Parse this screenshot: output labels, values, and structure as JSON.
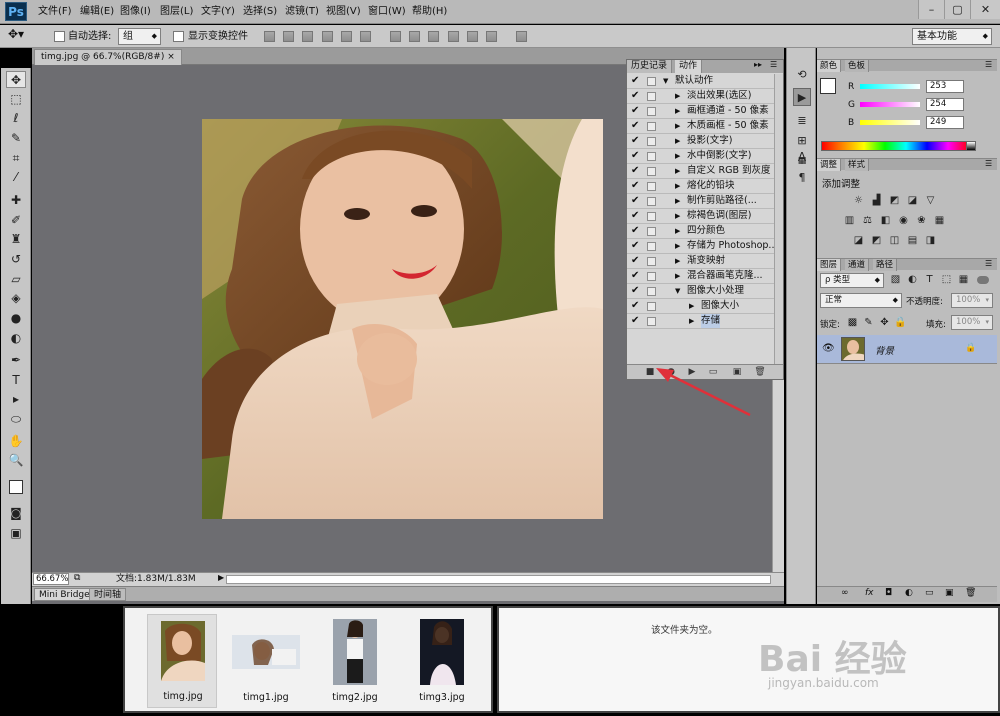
{
  "app": {
    "logo": "Ps",
    "menus": [
      "文件(F)",
      "编辑(E)",
      "图像(I)",
      "图层(L)",
      "文字(Y)",
      "选择(S)",
      "滤镜(T)",
      "视图(V)",
      "窗口(W)",
      "帮助(H)"
    ],
    "window_controls": [
      "–",
      "▢",
      "✕"
    ]
  },
  "options": {
    "auto_select_label": "自动选择:",
    "auto_select_value": "组",
    "show_transform_label": "显示变换控件",
    "workspace": "基本功能"
  },
  "document": {
    "tab_title": "timg.jpg @ 66.7%(RGB/8#)",
    "zoom": "66.67%",
    "doc_info": "文档:1.83M/1.83M"
  },
  "bottom_tabs": [
    "Mini Bridge",
    "时间轴"
  ],
  "actions_panel": {
    "tabs": [
      "历史记录",
      "动作"
    ],
    "active_tab": "动作",
    "set_name": "默认动作",
    "items": [
      "淡出效果(选区)",
      "画框通道 - 50 像素",
      "木质画框 - 50 像素",
      "投影(文字)",
      "水中倒影(文字)",
      "自定义 RGB 到灰度",
      "熔化的铅块",
      "制作剪贴路径(...",
      "棕褐色调(图层)",
      "四分颜色",
      "存储为 Photoshop...",
      "渐变映射",
      "混合器画笔克隆...",
      "图像大小处理"
    ],
    "sub_items": [
      "图像大小",
      "存储"
    ],
    "footer_icons": [
      "■",
      "●",
      "▶",
      "▭",
      "▣",
      "🗑"
    ]
  },
  "color_panel": {
    "tabs": [
      "颜色",
      "色板"
    ],
    "labels": [
      "R",
      "G",
      "B"
    ],
    "values": [
      "253",
      "254",
      "249"
    ]
  },
  "adjust_panel": {
    "tabs": [
      "调整",
      "样式"
    ],
    "title": "添加调整"
  },
  "layers_panel": {
    "tabs": [
      "图层",
      "通道",
      "路径"
    ],
    "filter_label": "ρ 类型",
    "blend_mode": "正常",
    "opacity_label": "不透明度:",
    "opacity_value": "100%",
    "lock_label": "锁定:",
    "fill_label": "填充:",
    "fill_value": "100%",
    "layer_name": "背景"
  },
  "mini_bridge": {
    "thumbnails": [
      "timg.jpg",
      "timg1.jpg",
      "timg2.jpg",
      "timg3.jpg"
    ],
    "empty_message": "该文件夹为空。"
  },
  "watermark": {
    "brand": "Bai 经验",
    "url": "jingyan.baidu.com"
  },
  "colors": {
    "accent_red": "#e0303a",
    "layer_highlight": "#a9b9da"
  }
}
